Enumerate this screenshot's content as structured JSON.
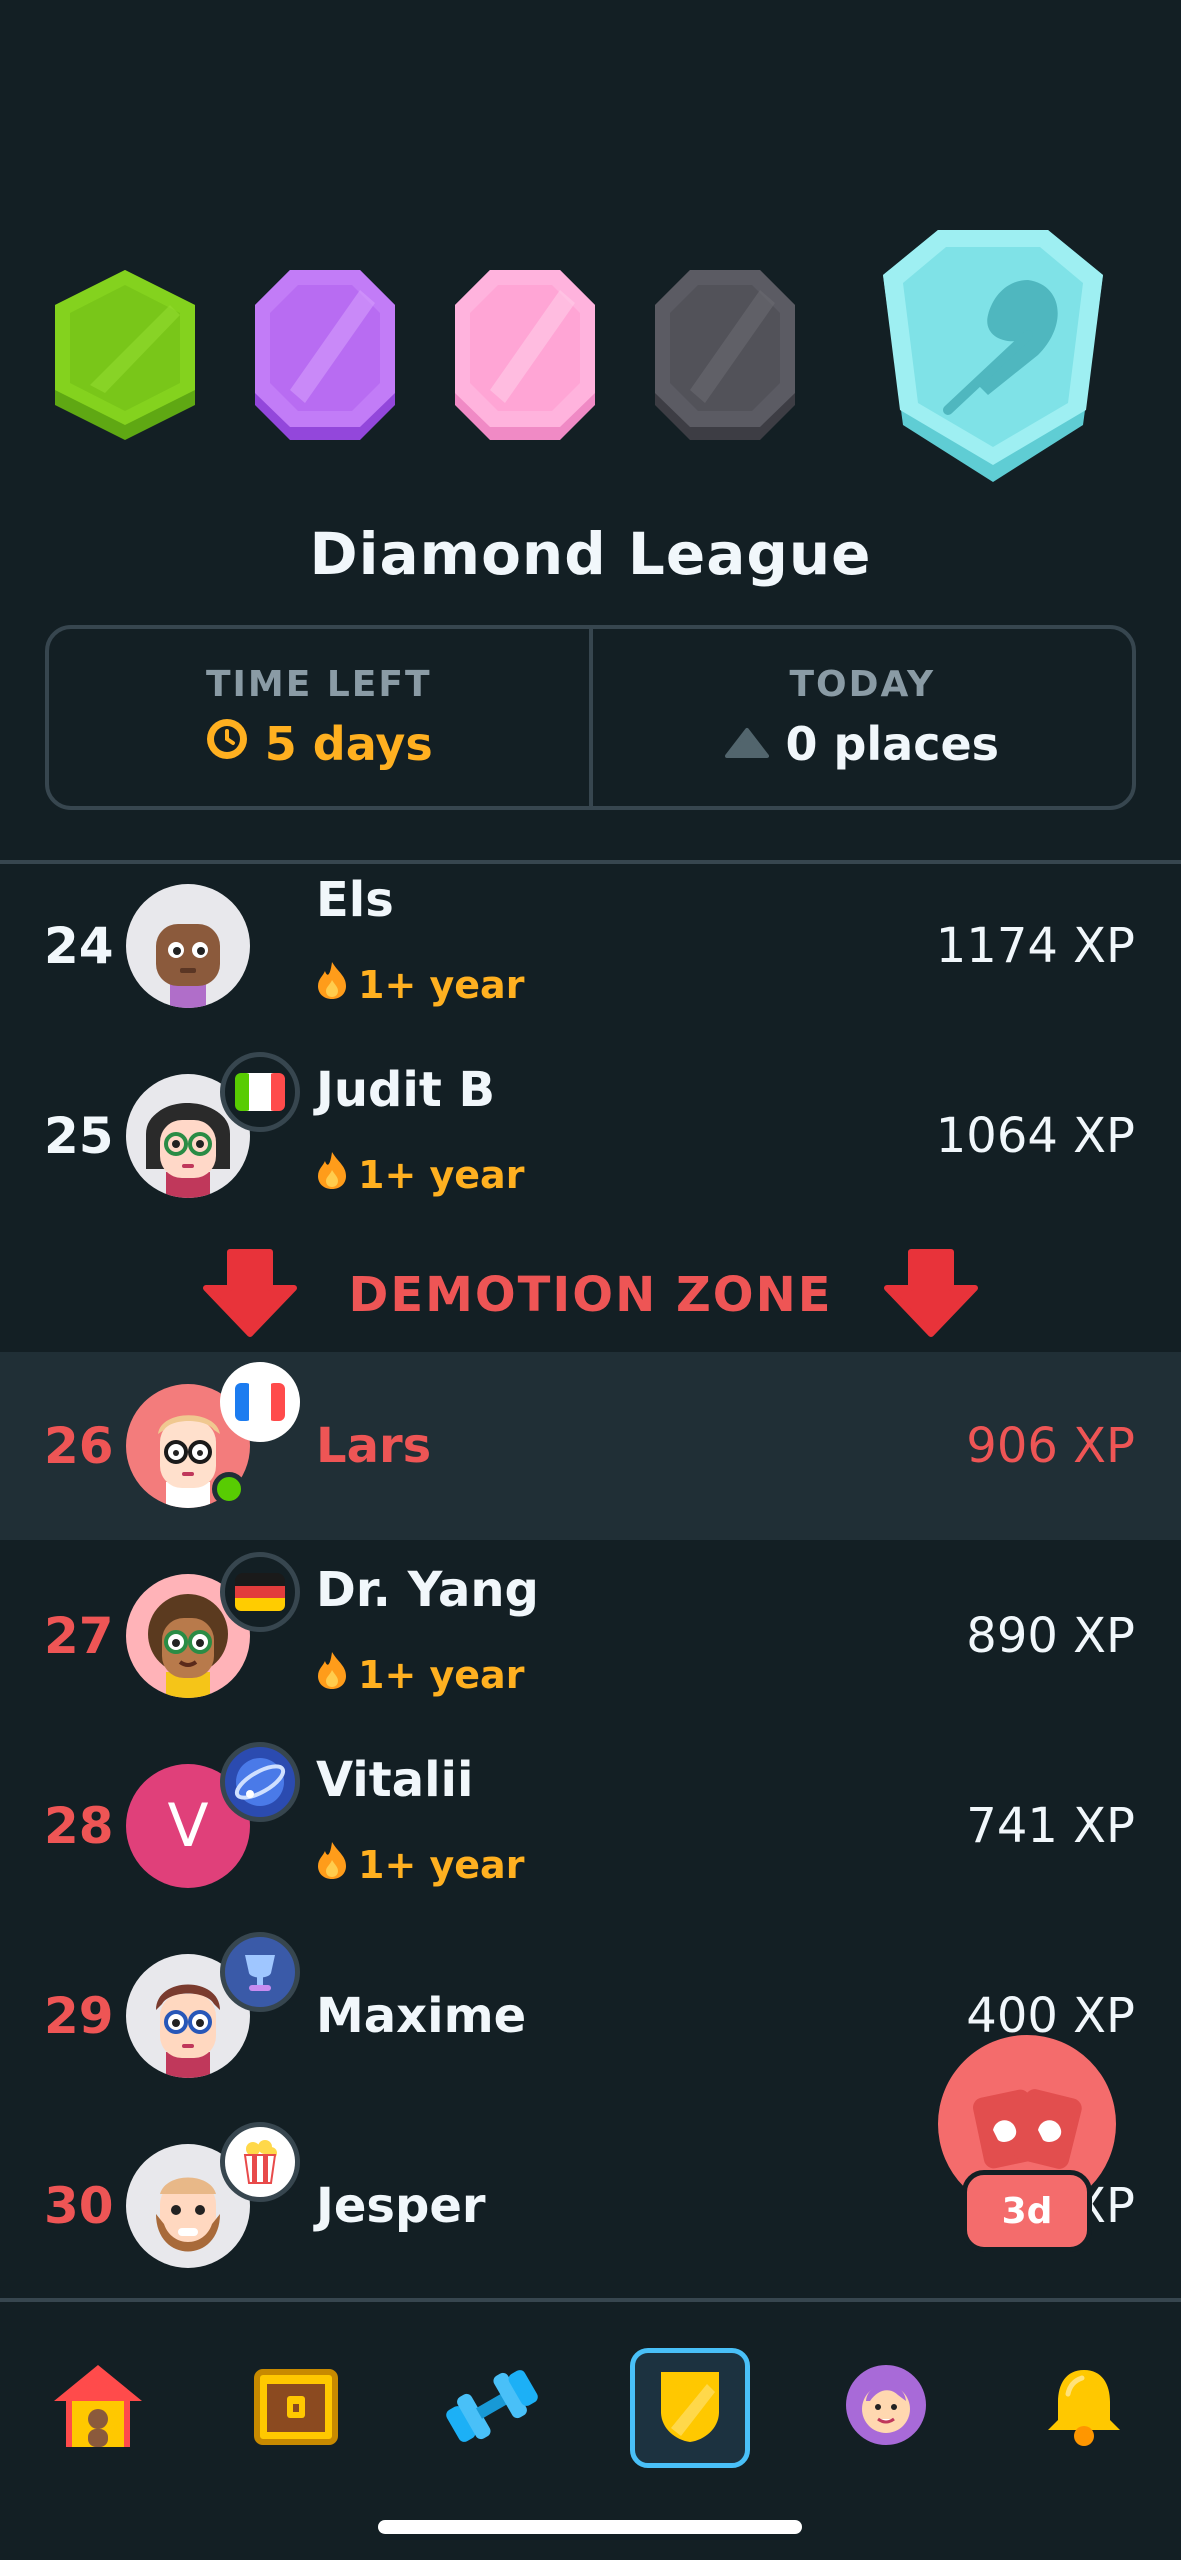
{
  "league": {
    "title": "Diamond League",
    "badges": [
      {
        "name": "bronze-league-badge",
        "color": "#7ed321"
      },
      {
        "name": "amethyst-league-badge",
        "color": "#c07af5"
      },
      {
        "name": "pearl-league-badge",
        "color": "#ffb0d9"
      },
      {
        "name": "obsidian-league-badge",
        "color": "#5a5a62"
      },
      {
        "name": "diamond-league-badge",
        "color": "#8fe6ea"
      }
    ]
  },
  "stats": {
    "time_left_label": "TIME LEFT",
    "time_left_value": "5 days",
    "today_label": "TODAY",
    "today_value": "0 places"
  },
  "leaderboard": [
    {
      "rank": "24",
      "name": "Els",
      "streak": "1+ year",
      "xp": "1174 XP"
    },
    {
      "rank": "25",
      "name": "Judit B",
      "streak": "1+ year",
      "xp": "1064 XP",
      "flag": "italy-flag-icon"
    },
    {
      "rank": "26",
      "name": "Lars",
      "streak": "",
      "xp": "906 XP",
      "flag": "france-flag-icon",
      "current_user": true
    },
    {
      "rank": "27",
      "name": "Dr. Yang",
      "streak": "1+ year",
      "xp": "890 XP",
      "flag": "germany-flag-icon"
    },
    {
      "rank": "28",
      "name": "Vitalii",
      "streak": "1+ year",
      "xp": "741 XP",
      "avatar_letter": "V",
      "flag": "globe-icon"
    },
    {
      "rank": "29",
      "name": "Maxime",
      "streak": "",
      "xp": "400 XP",
      "flag": "trophy-cup-icon"
    },
    {
      "rank": "30",
      "name": "Jesper",
      "streak": "",
      "xp": "XP",
      "flag": "popcorn-icon"
    }
  ],
  "demotion_zone": {
    "label": "DEMOTION ZONE"
  },
  "fab": {
    "label": "3d"
  },
  "colors": {
    "background": "#131f24",
    "accent_orange": "#ffb020",
    "accent_red": "#ee5555",
    "active_blue": "#49c0f8"
  },
  "nav": [
    "home-icon",
    "treasure-chest-icon",
    "dumbbell-icon",
    "shield-icon",
    "profile-icon",
    "bell-icon"
  ]
}
